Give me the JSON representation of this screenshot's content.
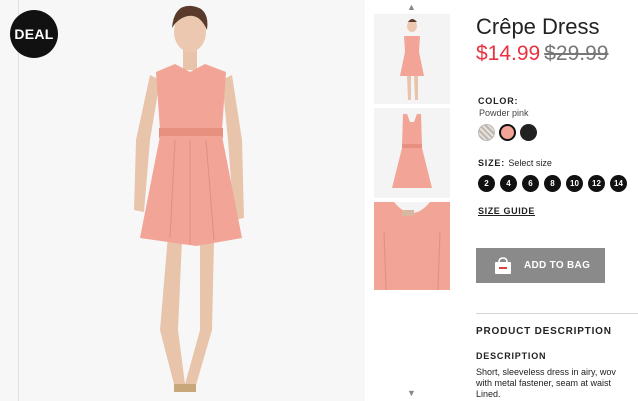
{
  "badge": {
    "deal": "DEAL"
  },
  "product": {
    "title": "Crêpe Dress",
    "price_now": "$14.99",
    "price_was": "$29.99"
  },
  "color": {
    "label": "COLOR:",
    "selected": "Powder pink",
    "swatches": [
      {
        "name": "patterned",
        "hex": "#d9d4cf"
      },
      {
        "name": "powder-pink",
        "hex": "#f2a497"
      },
      {
        "name": "black",
        "hex": "#222222"
      }
    ]
  },
  "size": {
    "label": "SIZE:",
    "prompt": "Select size",
    "options": [
      "2",
      "4",
      "6",
      "8",
      "10",
      "12",
      "14"
    ]
  },
  "size_guide": "SIZE GUIDE",
  "add_to_bag": {
    "label": "ADD TO BAG",
    "icon": "shopping-bag-icon"
  },
  "description": {
    "section_title": "PRODUCT DESCRIPTION",
    "heading": "DESCRIPTION",
    "lines": [
      "Short, sleeveless dress in airy, wov",
      "with metal fastener, seam at waist",
      "Lined."
    ]
  },
  "thumbnails": {
    "up_icon": "chevron-up-icon",
    "down_icon": "chevron-down-icon"
  },
  "colors": {
    "accent_red": "#e8323f",
    "button_gray": "#8a8a8a",
    "dress_pink": "#f2a497"
  }
}
